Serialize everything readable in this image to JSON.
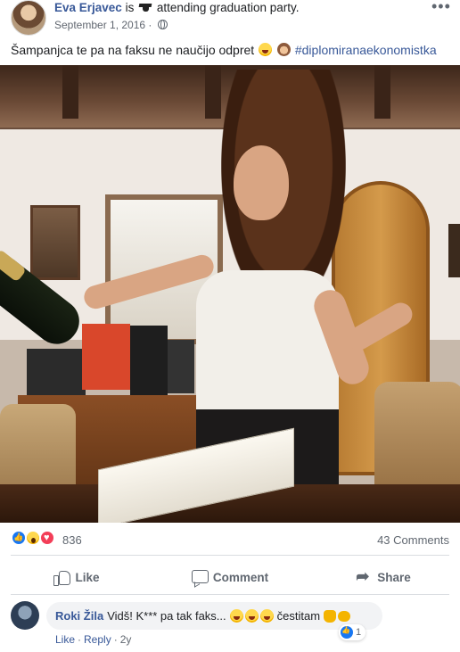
{
  "post": {
    "author": "Eva Erjavec",
    "is_text": "is",
    "activity": "attending graduation party.",
    "activity_icon": "graduation-cap-icon",
    "date": "September 1, 2016 ·",
    "privacy_icon": "globe-icon",
    "caption_text": "Šampanjca te pa na faksu ne naučijo odpret",
    "caption_hashtag": "#diplomiranaekonomistka"
  },
  "stats": {
    "reaction_count": "836",
    "comments": "43 Comments"
  },
  "actions": {
    "like": "Like",
    "comment": "Comment",
    "share": "Share"
  },
  "comment": {
    "name": "Roki Žila",
    "text": "Vidš! K*** pa tak faks...",
    "suffix": "čestitam",
    "reaction_count": "1",
    "like_link": "Like",
    "sep": "·",
    "reply_link": "Reply",
    "age": "2y"
  },
  "colors": {
    "link": "#385898",
    "muted": "#606770",
    "like_blue": "#1877f2",
    "love_red": "#f33e58",
    "bubble": "#f2f3f5"
  }
}
